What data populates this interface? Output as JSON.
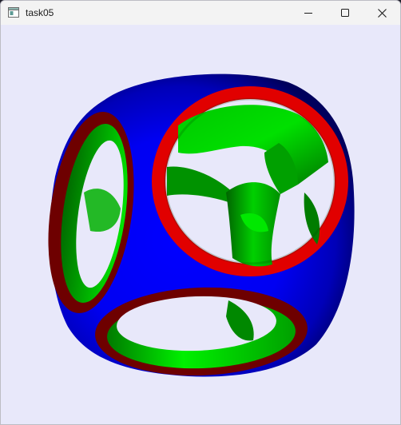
{
  "window": {
    "title": "task05",
    "app_icon": "window-app-icon",
    "controls": {
      "minimize_icon": "minimize-icon",
      "maximize_icon": "maximize-icon",
      "close_icon": "close-icon"
    }
  },
  "scene": {
    "background_color": "#e8e8fa",
    "shell_color": "#0000ff",
    "inner_color": "#00e000",
    "rim_front_color": "#e00000",
    "rim_side_color": "#7a0000"
  }
}
